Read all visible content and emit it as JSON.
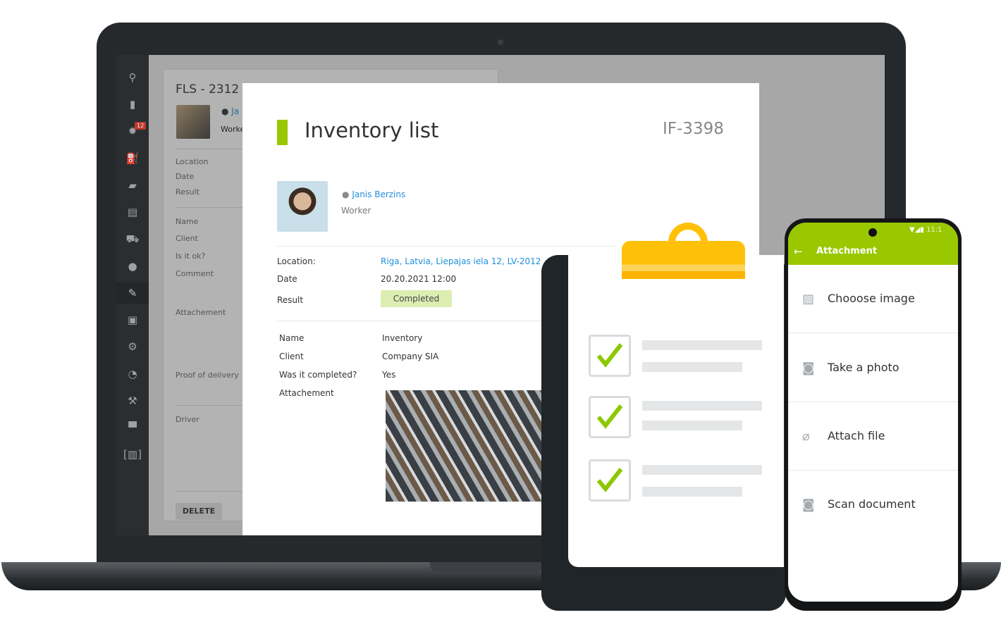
{
  "colors": {
    "accent_green": "#99c800",
    "link_blue": "#1e8fdc",
    "status_completed_bg": "#dcedb2",
    "clip_yellow": "#ffc107",
    "sidebar_bg": "#2a2e31"
  },
  "laptop": {
    "sidebar": {
      "items": [
        {
          "icon": "map-route-icon"
        },
        {
          "icon": "document-icon"
        },
        {
          "icon": "gear-badge-icon",
          "badge": "12"
        },
        {
          "icon": "fuel-icon"
        },
        {
          "icon": "chat-icon"
        },
        {
          "icon": "clipboard-icon"
        },
        {
          "icon": "car-icon"
        },
        {
          "icon": "user-icon"
        },
        {
          "icon": "edit-form-icon"
        },
        {
          "icon": "calendar-icon"
        },
        {
          "icon": "settings-icon"
        },
        {
          "icon": "clock-icon"
        },
        {
          "icon": "tools-icon"
        },
        {
          "icon": "paint-roller-icon"
        },
        {
          "icon": "barcode-icon"
        }
      ]
    },
    "back_card": {
      "title": "FLS - 2312",
      "user_initial": "Ja",
      "role": "Worke",
      "fields": [
        "Location",
        "Date",
        "Result",
        "Name",
        "Client",
        "Is it ok?",
        "Comment",
        "Attachement",
        "Proof of delivery",
        "Driver"
      ],
      "delete_label": "DELETE"
    },
    "form": {
      "title": "Inventory list",
      "code": "IF-3398",
      "user_name": "Janis Berzins",
      "user_role": "Worker",
      "details": [
        {
          "label": "Location:",
          "value": "Riga, Latvia, Liepajas iela 12, LV-2012"
        },
        {
          "label": "Date",
          "value": "20.20.2021  12:00"
        },
        {
          "label": "Result",
          "value": "Completed"
        }
      ],
      "fields": [
        {
          "label": "Name",
          "value": "Inventory"
        },
        {
          "label": "Client",
          "value": "Company SIA"
        },
        {
          "label": "Was it completed?",
          "value": "Yes"
        },
        {
          "label": "Attachement",
          "value": ""
        }
      ]
    }
  },
  "clipboard": {
    "checked_items": 3
  },
  "phone": {
    "status_time": "11:1",
    "header_title": "Attachment",
    "options": [
      {
        "icon": "image-icon",
        "label": "Chooose image"
      },
      {
        "icon": "camera-icon",
        "label": "Take a photo"
      },
      {
        "icon": "paperclip-icon",
        "label": "Attach file"
      },
      {
        "icon": "camera-icon",
        "label": "Scan document"
      }
    ]
  }
}
